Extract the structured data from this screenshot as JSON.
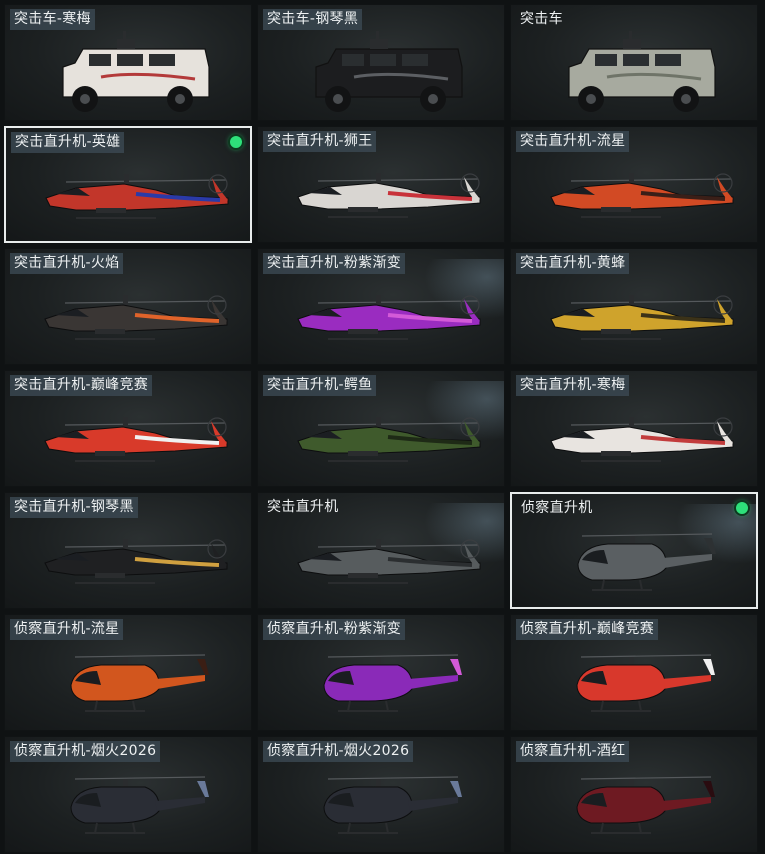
{
  "items": [
    {
      "label": "突击车-寒梅",
      "kind": "truck",
      "body": "#e6e2dc",
      "accent": "#b33a3a",
      "selected": false
    },
    {
      "label": "突击车-钢琴黑",
      "kind": "truck",
      "body": "#1c1d1f",
      "accent": "#5c5f63",
      "selected": false
    },
    {
      "label": "突击车",
      "kind": "truck",
      "body": "#a7aa9f",
      "accent": "#6f7468",
      "selected": false
    },
    {
      "label": "突击直升机-英雄",
      "kind": "attack",
      "body": "#c2362a",
      "accent": "#2a3aa8",
      "selected": true
    },
    {
      "label": "突击直升机-狮王",
      "kind": "attack",
      "body": "#d9d6d2",
      "accent": "#c8323a",
      "selected": false
    },
    {
      "label": "突击直升机-流星",
      "kind": "attack",
      "body": "#d24a24",
      "accent": "#3a1f18",
      "selected": false
    },
    {
      "label": "突击直升机-火焰",
      "kind": "attack",
      "body": "#3a3634",
      "accent": "#e0632a",
      "selected": false
    },
    {
      "label": "突击直升机-粉紫渐变",
      "kind": "attack",
      "body": "#9a2cc0",
      "accent": "#d35ad8",
      "selected": false
    },
    {
      "label": "突击直升机-黄蜂",
      "kind": "attack",
      "body": "#cfa32c",
      "accent": "#3b3218",
      "selected": false
    },
    {
      "label": "突击直升机-巅峰竞赛",
      "kind": "attack",
      "body": "#d83a2a",
      "accent": "#f0f0f0",
      "selected": false
    },
    {
      "label": "突击直升机-鳄鱼",
      "kind": "attack",
      "body": "#3f5a2c",
      "accent": "#1e2a16",
      "selected": false
    },
    {
      "label": "突击直升机-寒梅",
      "kind": "attack",
      "body": "#e8e4e0",
      "accent": "#c23c3c",
      "selected": false
    },
    {
      "label": "突击直升机-钢琴黑",
      "kind": "attack",
      "body": "#1f2022",
      "accent": "#d0a040",
      "selected": false
    },
    {
      "label": "突击直升机",
      "kind": "attack",
      "body": "#575c5e",
      "accent": "#2b2e30",
      "selected": false
    },
    {
      "label": "侦察直升机",
      "kind": "scout",
      "body": "#5a5f62",
      "accent": "#2d3133",
      "selected": true
    },
    {
      "label": "侦察直升机-流星",
      "kind": "scout",
      "body": "#d2561e",
      "accent": "#3a1e14",
      "selected": false
    },
    {
      "label": "侦察直升机-粉紫渐变",
      "kind": "scout",
      "body": "#8a2ab8",
      "accent": "#d35ad8",
      "selected": false
    },
    {
      "label": "侦察直升机-巅峰竞赛",
      "kind": "scout",
      "body": "#d8382c",
      "accent": "#f0f0f0",
      "selected": false
    },
    {
      "label": "侦察直升机-烟火2026",
      "kind": "scout",
      "body": "#2a2d35",
      "accent": "#6a7a9a",
      "selected": false
    },
    {
      "label": "侦察直升机-烟火2026",
      "kind": "scout",
      "body": "#2a2d35",
      "accent": "#6a7a9a",
      "selected": false
    },
    {
      "label": "侦察直升机-酒红",
      "kind": "scout",
      "body": "#6e1a22",
      "accent": "#2a0c10",
      "selected": false
    }
  ]
}
